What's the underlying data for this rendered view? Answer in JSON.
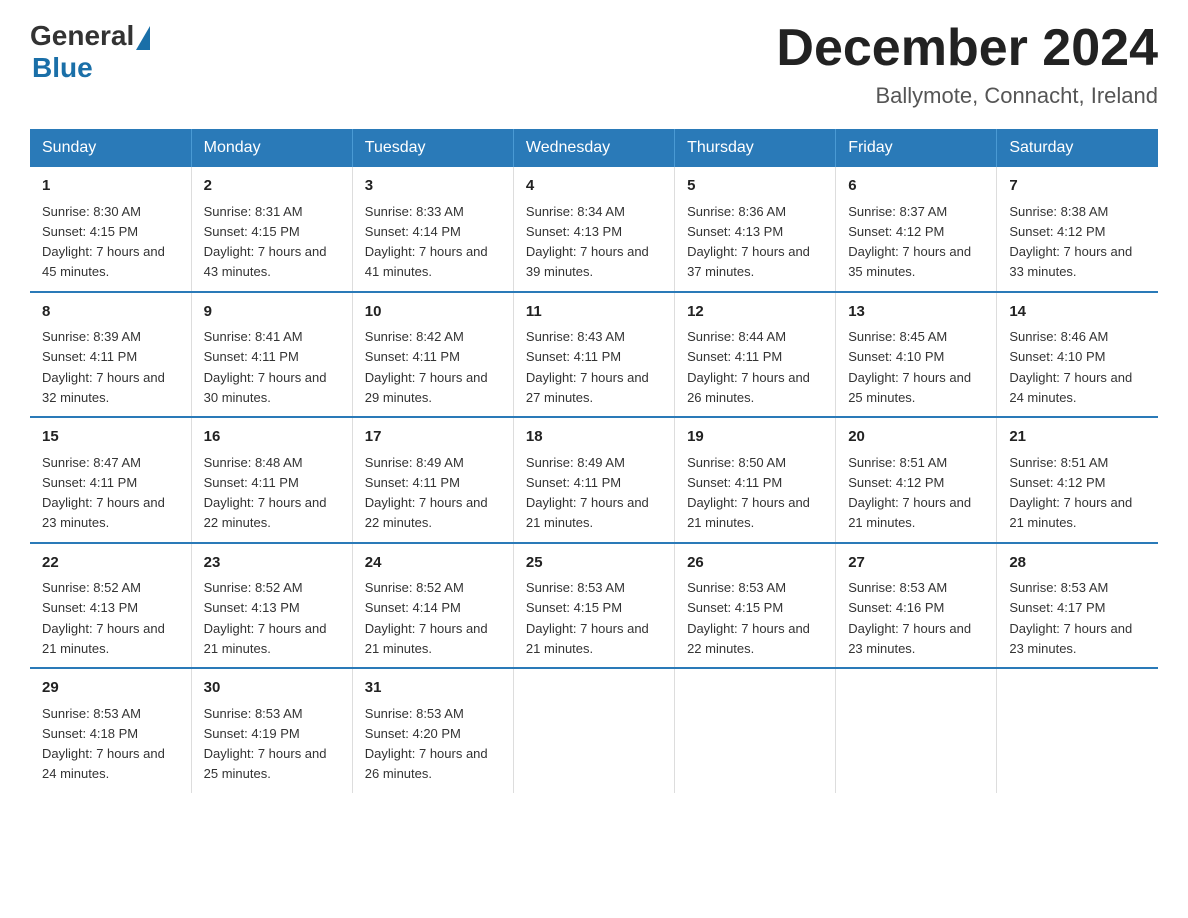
{
  "header": {
    "logo_general": "General",
    "logo_blue": "Blue",
    "title": "December 2024",
    "subtitle": "Ballymote, Connacht, Ireland"
  },
  "days_of_week": [
    "Sunday",
    "Monday",
    "Tuesday",
    "Wednesday",
    "Thursday",
    "Friday",
    "Saturday"
  ],
  "weeks": [
    [
      {
        "day": "1",
        "sunrise": "8:30 AM",
        "sunset": "4:15 PM",
        "daylight": "7 hours and 45 minutes."
      },
      {
        "day": "2",
        "sunrise": "8:31 AM",
        "sunset": "4:15 PM",
        "daylight": "7 hours and 43 minutes."
      },
      {
        "day": "3",
        "sunrise": "8:33 AM",
        "sunset": "4:14 PM",
        "daylight": "7 hours and 41 minutes."
      },
      {
        "day": "4",
        "sunrise": "8:34 AM",
        "sunset": "4:13 PM",
        "daylight": "7 hours and 39 minutes."
      },
      {
        "day": "5",
        "sunrise": "8:36 AM",
        "sunset": "4:13 PM",
        "daylight": "7 hours and 37 minutes."
      },
      {
        "day": "6",
        "sunrise": "8:37 AM",
        "sunset": "4:12 PM",
        "daylight": "7 hours and 35 minutes."
      },
      {
        "day": "7",
        "sunrise": "8:38 AM",
        "sunset": "4:12 PM",
        "daylight": "7 hours and 33 minutes."
      }
    ],
    [
      {
        "day": "8",
        "sunrise": "8:39 AM",
        "sunset": "4:11 PM",
        "daylight": "7 hours and 32 minutes."
      },
      {
        "day": "9",
        "sunrise": "8:41 AM",
        "sunset": "4:11 PM",
        "daylight": "7 hours and 30 minutes."
      },
      {
        "day": "10",
        "sunrise": "8:42 AM",
        "sunset": "4:11 PM",
        "daylight": "7 hours and 29 minutes."
      },
      {
        "day": "11",
        "sunrise": "8:43 AM",
        "sunset": "4:11 PM",
        "daylight": "7 hours and 27 minutes."
      },
      {
        "day": "12",
        "sunrise": "8:44 AM",
        "sunset": "4:11 PM",
        "daylight": "7 hours and 26 minutes."
      },
      {
        "day": "13",
        "sunrise": "8:45 AM",
        "sunset": "4:10 PM",
        "daylight": "7 hours and 25 minutes."
      },
      {
        "day": "14",
        "sunrise": "8:46 AM",
        "sunset": "4:10 PM",
        "daylight": "7 hours and 24 minutes."
      }
    ],
    [
      {
        "day": "15",
        "sunrise": "8:47 AM",
        "sunset": "4:11 PM",
        "daylight": "7 hours and 23 minutes."
      },
      {
        "day": "16",
        "sunrise": "8:48 AM",
        "sunset": "4:11 PM",
        "daylight": "7 hours and 22 minutes."
      },
      {
        "day": "17",
        "sunrise": "8:49 AM",
        "sunset": "4:11 PM",
        "daylight": "7 hours and 22 minutes."
      },
      {
        "day": "18",
        "sunrise": "8:49 AM",
        "sunset": "4:11 PM",
        "daylight": "7 hours and 21 minutes."
      },
      {
        "day": "19",
        "sunrise": "8:50 AM",
        "sunset": "4:11 PM",
        "daylight": "7 hours and 21 minutes."
      },
      {
        "day": "20",
        "sunrise": "8:51 AM",
        "sunset": "4:12 PM",
        "daylight": "7 hours and 21 minutes."
      },
      {
        "day": "21",
        "sunrise": "8:51 AM",
        "sunset": "4:12 PM",
        "daylight": "7 hours and 21 minutes."
      }
    ],
    [
      {
        "day": "22",
        "sunrise": "8:52 AM",
        "sunset": "4:13 PM",
        "daylight": "7 hours and 21 minutes."
      },
      {
        "day": "23",
        "sunrise": "8:52 AM",
        "sunset": "4:13 PM",
        "daylight": "7 hours and 21 minutes."
      },
      {
        "day": "24",
        "sunrise": "8:52 AM",
        "sunset": "4:14 PM",
        "daylight": "7 hours and 21 minutes."
      },
      {
        "day": "25",
        "sunrise": "8:53 AM",
        "sunset": "4:15 PM",
        "daylight": "7 hours and 21 minutes."
      },
      {
        "day": "26",
        "sunrise": "8:53 AM",
        "sunset": "4:15 PM",
        "daylight": "7 hours and 22 minutes."
      },
      {
        "day": "27",
        "sunrise": "8:53 AM",
        "sunset": "4:16 PM",
        "daylight": "7 hours and 23 minutes."
      },
      {
        "day": "28",
        "sunrise": "8:53 AM",
        "sunset": "4:17 PM",
        "daylight": "7 hours and 23 minutes."
      }
    ],
    [
      {
        "day": "29",
        "sunrise": "8:53 AM",
        "sunset": "4:18 PM",
        "daylight": "7 hours and 24 minutes."
      },
      {
        "day": "30",
        "sunrise": "8:53 AM",
        "sunset": "4:19 PM",
        "daylight": "7 hours and 25 minutes."
      },
      {
        "day": "31",
        "sunrise": "8:53 AM",
        "sunset": "4:20 PM",
        "daylight": "7 hours and 26 minutes."
      },
      null,
      null,
      null,
      null
    ]
  ]
}
